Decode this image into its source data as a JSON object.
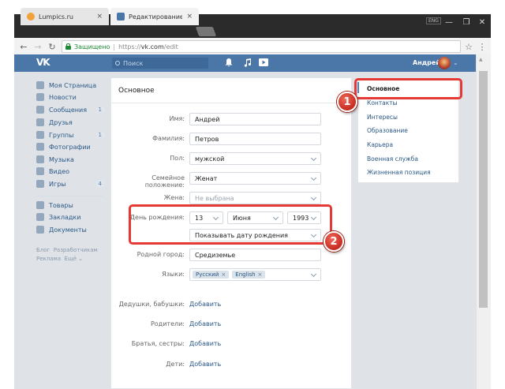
{
  "browser": {
    "tabs": [
      {
        "title": "Lumpics.ru",
        "fav_color": "#f2a23a",
        "close": "×"
      },
      {
        "title": "Редактирование моей с",
        "fav_color": "#4a76a8",
        "close": "×"
      }
    ],
    "lang": "ENG",
    "window_controls": [
      "—",
      "❐",
      "✕"
    ],
    "nav": {
      "back": "←",
      "forward": "→",
      "reload": "↻"
    },
    "secure_label": "Защищено",
    "url_scheme": "https://",
    "url_host": "vk.com",
    "url_path": "/edit",
    "star": "☆",
    "menu": "⋮"
  },
  "vk_header": {
    "logo": "VK",
    "search_placeholder": "Поиск",
    "icons": [
      "bell-icon",
      "music-icon",
      "video-icon"
    ],
    "user_name": "Андрей",
    "chevron": "⌄"
  },
  "left_menu": {
    "items": [
      {
        "label": "Моя Страница",
        "count": ""
      },
      {
        "label": "Новости",
        "count": ""
      },
      {
        "label": "Сообщения",
        "count": "1"
      },
      {
        "label": "Друзья",
        "count": ""
      },
      {
        "label": "Группы",
        "count": "1"
      },
      {
        "label": "Фотографии",
        "count": ""
      },
      {
        "label": "Музыка",
        "count": ""
      },
      {
        "label": "Видео",
        "count": ""
      },
      {
        "label": "Игры",
        "count": "4"
      }
    ],
    "items2": [
      {
        "label": "Товары"
      },
      {
        "label": "Закладки"
      },
      {
        "label": "Документы"
      }
    ],
    "small_links": [
      "Блог",
      "Разработчикам",
      "Реклама",
      "Ещё ⌄"
    ]
  },
  "form": {
    "title": "Основное",
    "name_label": "Имя:",
    "name_value": "Андрей",
    "surname_label": "Фамилия:",
    "surname_value": "Петров",
    "sex_label": "Пол:",
    "sex_value": "мужской",
    "family_label": "Семейное положение:",
    "family_value": "Женат",
    "wife_label": "Жена:",
    "wife_value": "Не выбрана",
    "birthday_label": "День рождения:",
    "birth_day": "13",
    "birth_month": "Июня",
    "birth_year": "1993",
    "birth_visibility": "Показывать дату рождения",
    "hometown_label": "Родной город:",
    "hometown_value": "Средиземье",
    "languages_label": "Языки:",
    "languages": [
      "Русский",
      "English"
    ],
    "grandparents_label": "Дедушки, бабушки:",
    "parents_label": "Родители:",
    "siblings_label": "Братья, сестры:",
    "children_label": "Дети:",
    "add_label": "Добавить",
    "remove_x": "×"
  },
  "right_menu": {
    "items": [
      "Основное",
      "Контакты",
      "Интересы",
      "Образование",
      "Карьера",
      "Военная служба",
      "Жизненная позиция"
    ]
  },
  "callouts": {
    "one": "1",
    "two": "2",
    "color": "#e53935"
  }
}
